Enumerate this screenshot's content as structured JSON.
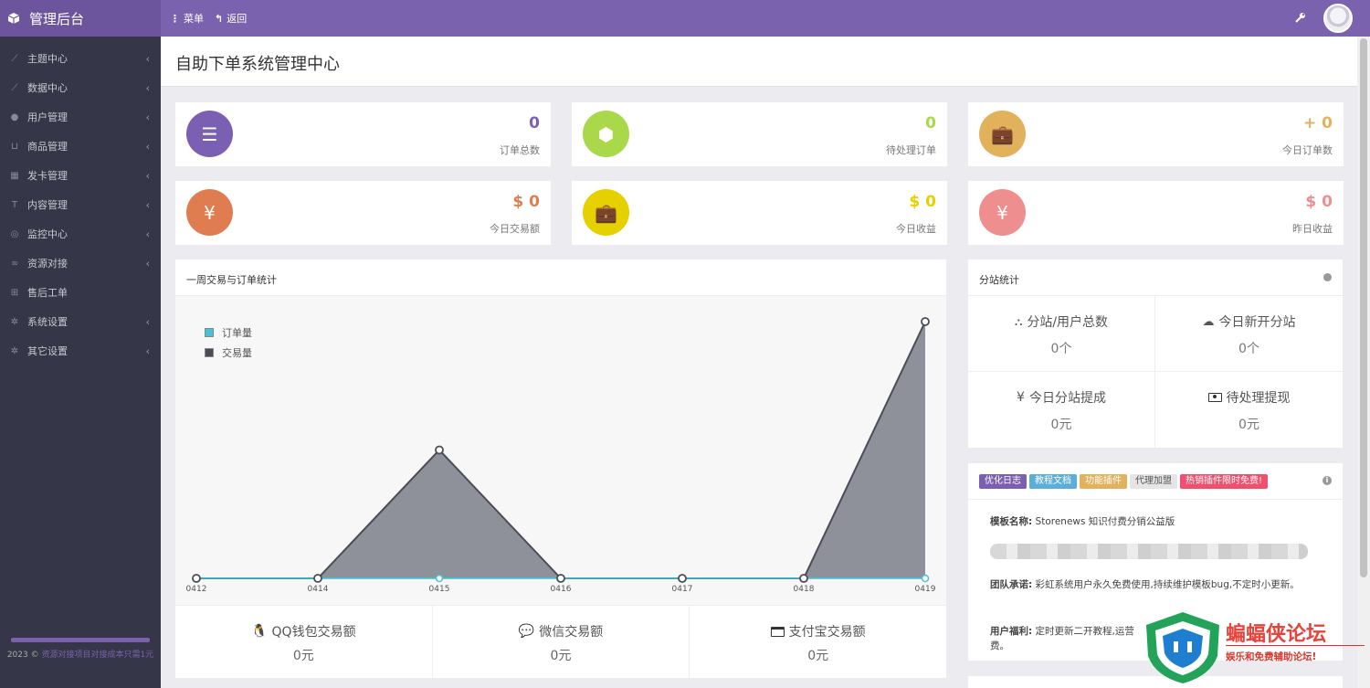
{
  "topbar": {
    "brand": "管理后台",
    "menu_label": "菜单",
    "back_label": "返回"
  },
  "sidebar": {
    "items": [
      {
        "label": "主题中心",
        "icon": "line-chart-icon",
        "has_chevron": true
      },
      {
        "label": "数据中心",
        "icon": "area-chart-icon",
        "has_chevron": true
      },
      {
        "label": "用户管理",
        "icon": "user-icon",
        "has_chevron": true
      },
      {
        "label": "商品管理",
        "icon": "cart-icon",
        "has_chevron": true
      },
      {
        "label": "发卡管理",
        "icon": "grid-icon",
        "has_chevron": true
      },
      {
        "label": "内容管理",
        "icon": "text-icon",
        "has_chevron": true
      },
      {
        "label": "监控中心",
        "icon": "target-icon",
        "has_chevron": true
      },
      {
        "label": "资源对接",
        "icon": "link-icon",
        "has_chevron": true
      },
      {
        "label": "售后工单",
        "icon": "ticket-icon",
        "has_chevron": false
      },
      {
        "label": "系统设置",
        "icon": "gear-icon",
        "has_chevron": true
      },
      {
        "label": "其它设置",
        "icon": "gears-icon",
        "has_chevron": true
      }
    ],
    "footer_prefix": "2023 © ",
    "footer_link": "资源对接项目对接成本只需1元"
  },
  "page_title": "自助下单系统管理中心",
  "stats": [
    {
      "value": "0",
      "label": "订单总数",
      "color": "#7b5fb2",
      "icon": "list-icon"
    },
    {
      "value": "0",
      "label": "待处理订单",
      "color": "#a9d84a",
      "icon": "cube-icon"
    },
    {
      "value": "+ 0",
      "label": "今日订单数",
      "color": "#e2b15c",
      "icon": "briefcase-icon"
    },
    {
      "value": "$ 0",
      "label": "今日交易额",
      "color": "#e07d50",
      "icon": "yen-icon"
    },
    {
      "value": "$ 0",
      "label": "今日收益",
      "color": "#e6d000",
      "icon": "briefcase-icon"
    },
    {
      "value": "$ 0",
      "label": "昨日收益",
      "color": "#ef8e8e",
      "icon": "yen-icon"
    }
  ],
  "chart_panel_title": "一周交易与订单统计",
  "chart_data": {
    "type": "area",
    "x": [
      "0412",
      "0414",
      "0415",
      "0416",
      "0417",
      "0418",
      "0419"
    ],
    "series": [
      {
        "name": "订单量",
        "values": [
          0,
          0,
          0,
          0,
          0,
          0,
          0
        ],
        "color": "#47c1d6"
      },
      {
        "name": "交易量",
        "values": [
          0,
          0,
          1,
          0,
          0,
          0,
          2
        ],
        "color": "#4a4d57"
      }
    ],
    "legend": "top-left",
    "grid": false
  },
  "payments": [
    {
      "label": "QQ钱包交易额",
      "value": "0元",
      "icon": "qq-icon"
    },
    {
      "label": "微信交易额",
      "value": "0元",
      "icon": "wechat-icon"
    },
    {
      "label": "支付宝交易额",
      "value": "0元",
      "icon": "credit-card-icon"
    }
  ],
  "substation": {
    "title": "分站统计",
    "cells": [
      {
        "label": "分站/用户总数",
        "value": "0个",
        "icon": "sitemap-icon"
      },
      {
        "label": "今日新开分站",
        "value": "0个",
        "icon": "cloud-icon"
      },
      {
        "label": "今日分站提成",
        "value": "0元",
        "icon": "yen-icon"
      },
      {
        "label": "待处理提现",
        "value": "0元",
        "icon": "money-icon"
      }
    ]
  },
  "info": {
    "tags": [
      {
        "label": "优化日志",
        "color": "#7b5fb2"
      },
      {
        "label": "教程文档",
        "color": "#5aaed8"
      },
      {
        "label": "功能插件",
        "color": "#e2b15c"
      },
      {
        "label": "代理加盟",
        "color": "#e5e5e5"
      },
      {
        "label": "热销插件限时免费!",
        "color": "#f0506e"
      }
    ],
    "template_label": "模板名称:",
    "template_value": "Storenews 知识付费分销公益版",
    "team_label": "团队承诺:",
    "team_value": "彩虹系统用户永久免费使用,持续维护模板bug,不定时小更新。",
    "welfare_label": "用户福利:",
    "welfare_value": "定时更新二开教程,运营",
    "welfare_tail": "费。"
  },
  "watermark": {
    "title": "蝙蝠侠论坛",
    "subtitle": "娱乐和免费辅助论坛!"
  }
}
